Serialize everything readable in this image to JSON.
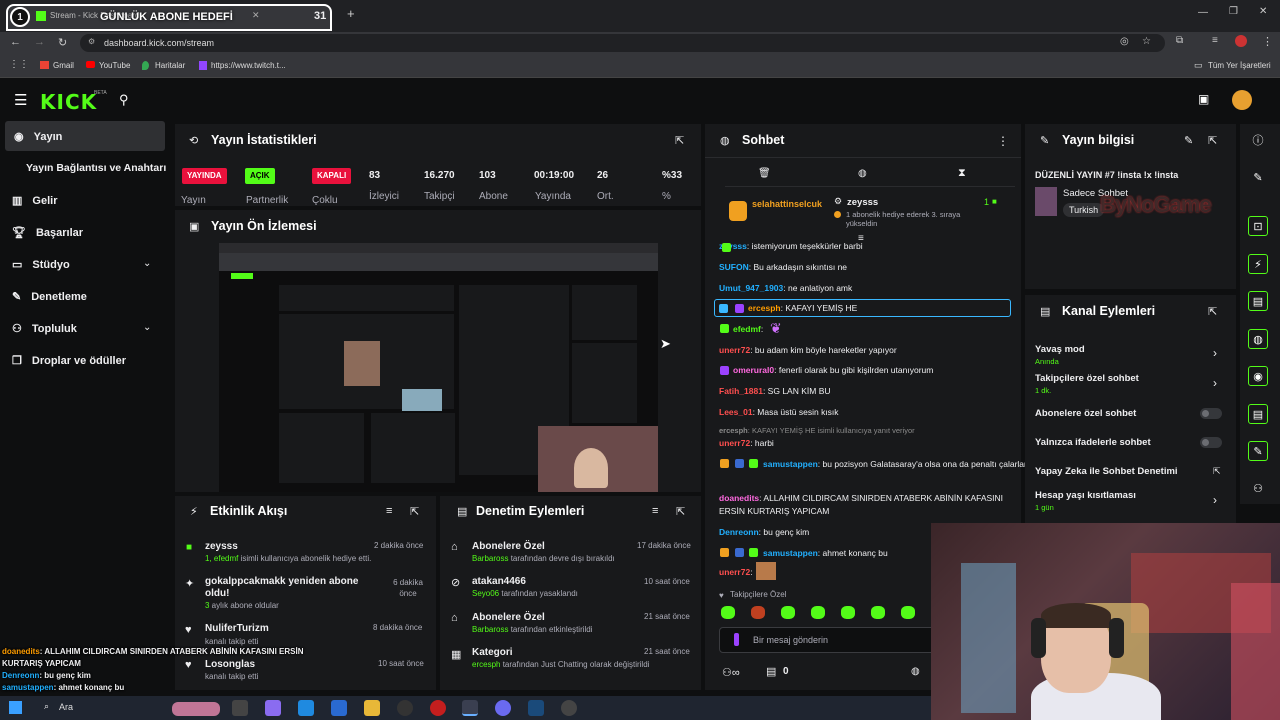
{
  "browser": {
    "tab_number": "1",
    "tab_title": "Stream - Kick Dashboard",
    "tab_overlay": "GÜNLÜK ABONE HEDEFİ",
    "tab_counter": "31",
    "url": "dashboard.kick.com/stream",
    "bookmarks": [
      "Gmail",
      "YouTube",
      "Haritalar",
      "https://www.twitch.t..."
    ],
    "all_bookmarks": "Tüm Yer İşaretleri"
  },
  "kick": {
    "logo": "KICK",
    "beta": "BETA"
  },
  "sidebar": {
    "items": [
      {
        "label": "Yayın"
      },
      {
        "label": "Yayın Bağlantısı ve Anahtarı"
      },
      {
        "label": "Gelir"
      },
      {
        "label": "Başarılar"
      },
      {
        "label": "Stüdyo"
      },
      {
        "label": "Denetleme"
      },
      {
        "label": "Topluluk"
      },
      {
        "label": "Droplar ve ödüller"
      }
    ]
  },
  "stats": {
    "title": "Yayın İstatistikleri",
    "badges": [
      {
        "text": "YAYINDA",
        "label": "Yayın"
      },
      {
        "text": "AÇIK",
        "label": "Partnerlik"
      },
      {
        "text": "KAPALI",
        "label": "Çoklu"
      }
    ],
    "values": [
      {
        "value": "83",
        "label": "İzleyici"
      },
      {
        "value": "16.270",
        "label": "Takipçi"
      },
      {
        "value": "103",
        "label": "Abone"
      },
      {
        "value": "00:19:00",
        "label": "Yayında"
      },
      {
        "value": "26",
        "label": "Ort."
      },
      {
        "value": "%33",
        "label": "%"
      }
    ]
  },
  "preview": {
    "title": "Yayın Ön İzlemesi"
  },
  "activity": {
    "title": "Etkinlik Akışı",
    "items": [
      {
        "name": "zeysss",
        "desc_name": "1, efedmf",
        "desc": " isimli kullanıcıya abonelik hediye etti.",
        "time": "2 dakika önce"
      },
      {
        "name": "gokalppcakmakk yeniden abone oldu!",
        "desc_name": "3",
        "desc": " aylık abone oldular",
        "time": "6 dakika önce"
      },
      {
        "name": "NuliferTurizm",
        "desc_name": "",
        "desc": "kanalı takip etti",
        "time": "8 dakika önce"
      },
      {
        "name": "Losonglas",
        "desc_name": "",
        "desc": "kanalı takip etti",
        "time": "10 saat önce"
      }
    ]
  },
  "moderation": {
    "title": "Denetim Eylemleri",
    "items": [
      {
        "title": "Abonelere Özel",
        "actor": "Barbaross",
        "desc": " tarafından devre dışı bırakıldı",
        "time": "17 dakika önce"
      },
      {
        "title": "atakan4466",
        "actor": "Seyo06",
        "desc": " tarafından yasaklandı",
        "time": "10 saat önce"
      },
      {
        "title": "Abonelere Özel",
        "actor": "Barbaross",
        "desc": " tarafından etkinleştirildi",
        "time": "21 saat önce"
      },
      {
        "title": "Kategori",
        "actor": "ercesph",
        "desc": " tarafından Just Chatting olarak değiştirildi",
        "time": "21 saat önce"
      }
    ]
  },
  "chat": {
    "title": "Sohbet",
    "pinned_user": "selahattinselcuk",
    "pinned_gifter": "zeysss",
    "pinned_count": "1",
    "pinned_desc": "1 abonelik hediye ederek 3. sıraya yükseldin",
    "messages": [
      {
        "user": "zeysss",
        "text": ": istemiyorum teşekkürler barbi",
        "color": "#22b0ff"
      },
      {
        "user": "SUFON",
        "text": ": Bu arkadaşın sıkıntısı ne",
        "color": "#22b0ff"
      },
      {
        "user": "Umut_947_1903",
        "text": ": ne anlatiyon amk",
        "color": "#22b0ff"
      },
      {
        "user": "ercesph",
        "text": ": KAFAYI YEMİŞ HE",
        "color": "#ff9d00"
      },
      {
        "user": "efedmf",
        "text": ":",
        "color": "#53fc18"
      },
      {
        "user": "unerr72",
        "text": ": bu adam kim böyle hareketler yapıyor",
        "color": "#ff4f4f"
      },
      {
        "user": "omerural0",
        "text": ": fenerli olarak bu gibi kişilrden utanıyorum",
        "color": "#ff6ae0"
      },
      {
        "user": "Fatih_1881",
        "text": ": SG LAN KİM BU",
        "color": "#ff4f4f"
      },
      {
        "user": "Lees_01",
        "text": ": Masa üstü sesin kısık",
        "color": "#ff4f4f"
      },
      {
        "user": "ercesph",
        "text": ": KAFAYI YEMİŞ HE isimli kullanıcıya yanıt veriyor",
        "color": "#8a8a8a"
      },
      {
        "user": "unerr72",
        "text": ": harbi",
        "color": "#ff4f4f"
      },
      {
        "user": "samustappen",
        "text": ": bu pozisyon Galatasaray'a olsa ona da penaltı çalarlardı",
        "color": "#22b0ff"
      },
      {
        "user": "doanedits",
        "text": ": ALLAHIM CILDIRCAM SINIRDEN ATABERK ABİNİN KAFASINI ERSİN KURTARIŞ YAPICAM",
        "color": "#ff6ae0"
      },
      {
        "user": "Denreonn",
        "text": ": bu genç kim",
        "color": "#22b0ff"
      },
      {
        "user": "samustappen",
        "text": ": ahmet konanç bu",
        "color": "#22b0ff"
      },
      {
        "user": "unerr72",
        "text": ":",
        "color": "#ff4f4f"
      }
    ],
    "followers_only": "Takipçilere Özel",
    "input_placeholder": "Bir mesaj gönderin",
    "gift_count": "0"
  },
  "stream_info": {
    "title": "Yayın bilgisi",
    "stream_title": "DÜZENLİ YAYIN #7 !insta !x !insta",
    "category": "Sadece Sohbet",
    "tag": "Turkish",
    "watermark": "ByNoGame"
  },
  "channel_actions": {
    "title": "Kanal Eylemleri",
    "items": [
      {
        "label": "Yavaş mod",
        "sub": "Anında",
        "type": "arrow"
      },
      {
        "label": "Takipçilere özel sohbet",
        "sub": "1 dk.",
        "type": "arrow"
      },
      {
        "label": "Abonelere özel sohbet",
        "sub": "",
        "type": "toggle"
      },
      {
        "label": "Yalnızca ifadelerle sohbet",
        "sub": "",
        "type": "toggle"
      },
      {
        "label": "Yapay Zeka ile Sohbet Denetimi",
        "sub": "",
        "type": "ext"
      },
      {
        "label": "Hesap yaşı kısıtlaması",
        "sub": "1 gün",
        "type": "arrow"
      }
    ]
  },
  "overlay_chat": [
    {
      "user": "doanedits",
      "text": ": ALLAHIM CILDIRCAM SINIRDEN ATABERK ABİNİN KAFASINI ERSİN KURTARIŞ YAPICAM"
    },
    {
      "user": "Denreonn",
      "text": ": bu genç kim"
    },
    {
      "user": "samustappen",
      "text": ": ahmet konanç bu"
    }
  ],
  "taskbar": {
    "search": "Ara"
  },
  "colors": {
    "kick_green": "#53fc18",
    "panel": "#18191b",
    "bg": "#0e0f10"
  }
}
